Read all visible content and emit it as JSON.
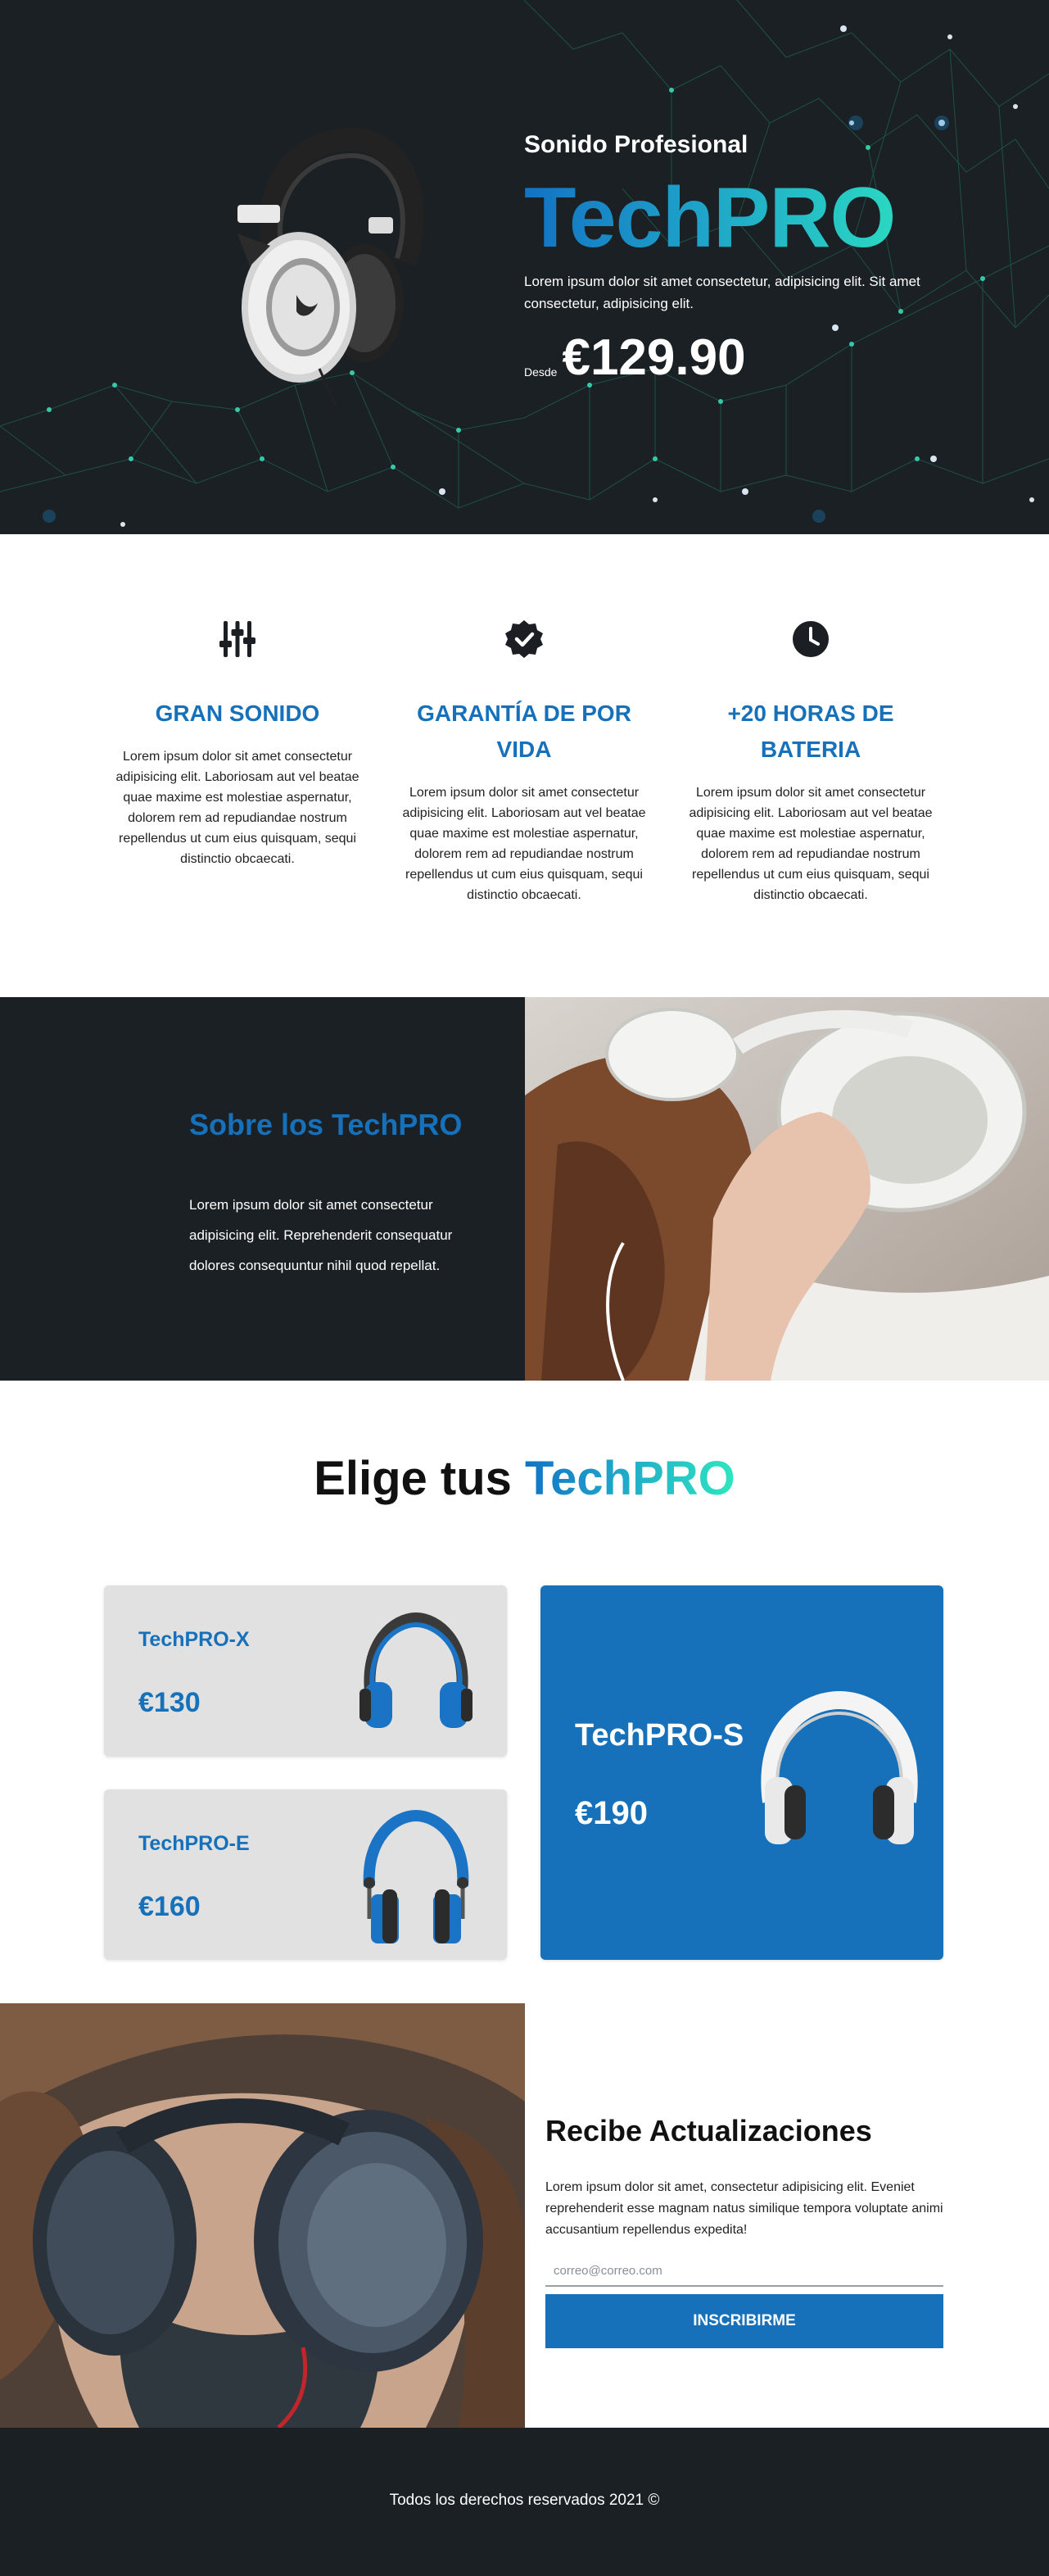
{
  "hero": {
    "subtitle": "Sonido Profesional",
    "brand": "TechPRO",
    "description": "Lorem ipsum dolor sit amet consectetur, adipisicing elit. Sit amet consectetur, adipisicing elit.",
    "price_prefix": "Desde",
    "price": "€129.90",
    "image": "headphones-black-white-icon"
  },
  "features": [
    {
      "icon": "sliders-icon",
      "title": "GRAN SONIDO",
      "text": "Lorem ipsum dolor sit amet consectetur adipisicing elit. Laboriosam aut vel beatae quae maxime est molestiae aspernatur, dolorem rem ad repudiandae nostrum repellendus ut cum eius quisquam, sequi distinctio obcaecati."
    },
    {
      "icon": "check-badge-icon",
      "title": "GARANTÍA DE POR VIDA",
      "text": "Lorem ipsum dolor sit amet consectetur adipisicing elit. Laboriosam aut vel beatae quae maxime est molestiae aspernatur, dolorem rem ad repudiandae nostrum repellendus ut cum eius quisquam, sequi distinctio obcaecati."
    },
    {
      "icon": "clock-icon",
      "title": "+20 HORAS DE BATERIA",
      "text": "Lorem ipsum dolor sit amet consectetur adipisicing elit. Laboriosam aut vel beatae quae maxime est molestiae aspernatur, dolorem rem ad repudiandae nostrum repellendus ut cum eius quisquam, sequi distinctio obcaecati."
    }
  ],
  "about": {
    "title": "Sobre los TechPRO",
    "text": "Lorem ipsum dolor sit amet consectetur adipisicing elit. Reprehenderit consequatur dolores consequuntur nihil quod repellat."
  },
  "choose": {
    "title_prefix": "Elige tus",
    "title_brand": "TechPRO",
    "products": [
      {
        "name": "TechPRO-X",
        "price": "€130"
      },
      {
        "name": "TechPRO-E",
        "price": "€160"
      },
      {
        "name": "TechPRO-S",
        "price": "€190"
      }
    ]
  },
  "newsletter": {
    "title": "Recibe Actualizaciones",
    "text": "Lorem ipsum dolor sit amet, consectetur adipisicing elit. Eveniet reprehenderit esse magnam natus similique tempora voluptate animi accusantium repellendus expedita!",
    "email_placeholder": "correo@correo.com",
    "button": "INSCRIBIRME"
  },
  "footer": {
    "text": "Todos los derechos reservados 2021 ©"
  },
  "colors": {
    "dark": "#1b2024",
    "primary": "#1671ba",
    "gradient_end": "#2ee6c0",
    "card_bg": "#e1e1e1"
  }
}
